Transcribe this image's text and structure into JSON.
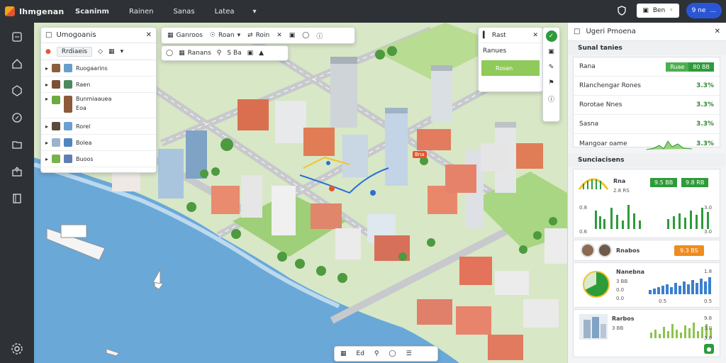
{
  "app": {
    "name": "Ihmgenan"
  },
  "topnav": {
    "items": [
      "Scaninm",
      "Rainen",
      "Sanas",
      "Latea"
    ]
  },
  "topright": {
    "date_label": "Ben",
    "user_label": "9 ne",
    "user_extra": "..."
  },
  "layers_panel": {
    "title": "Umogoanis",
    "sub_label": "Rrdiaeis",
    "rows": [
      "Ruogaarins",
      "Raen",
      "Bunmiaauea",
      "Eoa",
      "Rorel",
      "Bolea",
      "Buoos"
    ]
  },
  "toolbar1": {
    "items": [
      "Ganroos",
      "Roan",
      "Roin"
    ]
  },
  "toolbar2": {
    "items": [
      "Ranans",
      "S Ba"
    ]
  },
  "minipanel": {
    "title": "Rast",
    "row2": "Ranues",
    "bar_label": "Rosen"
  },
  "bottombar": {
    "label": "Ed"
  },
  "map_tag": {
    "label": "Bna"
  },
  "right_panel": {
    "title": "Ugeri Pmoena",
    "section1": "Sunal tanies",
    "section2": "Sunciacisens",
    "kv": [
      {
        "k": "Rana",
        "v": "Ruae",
        "badge": "80 BB"
      },
      {
        "k": "Rlanchengar Rones",
        "v": "3.3%"
      },
      {
        "k": "Rorotae Nnes",
        "v": "3.3%"
      },
      {
        "k": "Sasna",
        "v": "3.3%"
      },
      {
        "k": "Mangoar oame",
        "v": "3.3%"
      }
    ],
    "chart1": {
      "title": "Rna",
      "sub": "2.8 RS",
      "badge_a": "9.5 BB",
      "badge_b": "9.8 RB",
      "axis": [
        "0.8",
        "0.6",
        "3.0",
        "3.0"
      ]
    },
    "chart2": {
      "title": "Rnabos",
      "badge": "9.3 BS"
    },
    "chart3": {
      "title": "Nanebna",
      "sub": "3 BB",
      "badge": "1.8",
      "axis_l": [
        "0.0",
        "0.0"
      ],
      "axis_r": [
        "0.5",
        "0.5"
      ]
    },
    "chart4": {
      "title": "Rarbos",
      "sub": "3 BB",
      "badge": "9.8",
      "axis_r": [
        "3.0",
        "3.0"
      ]
    }
  },
  "colors": {
    "accent": "#2e9b3a",
    "brand": "#f2a21b",
    "water": "#5f9fd0",
    "orange": "#f08c1e",
    "topbar": "#2e3236"
  }
}
